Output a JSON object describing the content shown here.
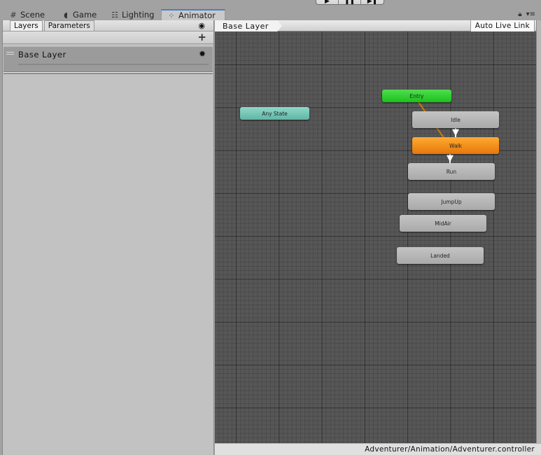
{
  "toolbar": {
    "play_icon": "play-icon",
    "pause_icon": "pause-icon",
    "step_icon": "step-icon"
  },
  "tabs": [
    {
      "label": "Scene",
      "icon": "grid-icon",
      "active": false
    },
    {
      "label": "Game",
      "icon": "pacman-icon",
      "active": false
    },
    {
      "label": "Lighting",
      "icon": "sliders-icon",
      "active": false
    },
    {
      "label": "Animator",
      "icon": "animator-icon",
      "active": true
    }
  ],
  "window_controls": {
    "lock_icon": "lock-icon",
    "menu_icon": "menu-icon"
  },
  "left_panel": {
    "tabs": [
      {
        "label": "Layers",
        "active": true
      },
      {
        "label": "Parameters",
        "active": false
      }
    ],
    "eye_icon": "eye-icon",
    "add_icon": "plus-icon",
    "layers": [
      {
        "name": "Base Layer",
        "settings_icon": "gear-icon"
      }
    ]
  },
  "graph": {
    "breadcrumb": "Base Layer",
    "auto_live_link": "Auto Live Link",
    "states": [
      {
        "id": "entry",
        "label": "Entry",
        "kind": "entry",
        "color": "#2ccc2c"
      },
      {
        "id": "any",
        "label": "Any State",
        "kind": "any",
        "color": "#7ccbb9"
      },
      {
        "id": "idle",
        "label": "Idle",
        "kind": "state",
        "color": "#b5b5b5"
      },
      {
        "id": "walk",
        "label": "Walk",
        "kind": "default",
        "color": "#f08c1a"
      },
      {
        "id": "run",
        "label": "Run",
        "kind": "state",
        "color": "#b5b5b5"
      },
      {
        "id": "jumpup",
        "label": "JumpUp",
        "kind": "state",
        "color": "#b5b5b5"
      },
      {
        "id": "midair",
        "label": "MidAir",
        "kind": "state",
        "color": "#b5b5b5"
      },
      {
        "id": "landed",
        "label": "Landed",
        "kind": "state",
        "color": "#b5b5b5"
      }
    ],
    "transitions": [
      {
        "from": "entry",
        "to": "walk",
        "color": "#c87a0a"
      },
      {
        "from": "idle",
        "to": "walk",
        "color": "#ffffff"
      },
      {
        "from": "walk",
        "to": "run",
        "color": "#ffffff"
      }
    ]
  },
  "status_bar": {
    "path": "Adventurer/Animation/Adventurer.controller"
  }
}
